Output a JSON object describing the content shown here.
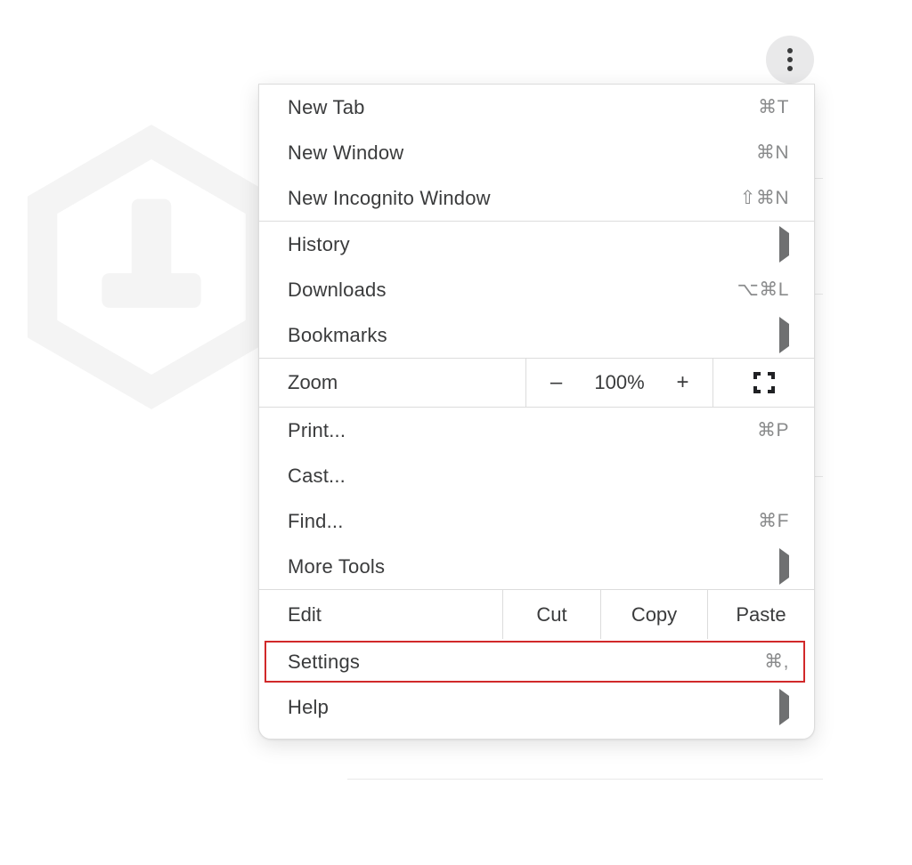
{
  "menu": {
    "section1": {
      "new_tab": {
        "label": "New Tab",
        "shortcut": "⌘T"
      },
      "new_window": {
        "label": "New Window",
        "shortcut": "⌘N"
      },
      "new_incognito": {
        "label": "New Incognito Window",
        "shortcut": "⇧⌘N"
      }
    },
    "section2": {
      "history": {
        "label": "History"
      },
      "downloads": {
        "label": "Downloads",
        "shortcut": "⌥⌘L"
      },
      "bookmarks": {
        "label": "Bookmarks"
      }
    },
    "zoom": {
      "label": "Zoom",
      "minus": "–",
      "value": "100%",
      "plus": "+"
    },
    "section3": {
      "print": {
        "label": "Print...",
        "shortcut": "⌘P"
      },
      "cast": {
        "label": "Cast..."
      },
      "find": {
        "label": "Find...",
        "shortcut": "⌘F"
      },
      "more_tools": {
        "label": "More Tools"
      }
    },
    "edit": {
      "label": "Edit",
      "cut": "Cut",
      "copy": "Copy",
      "paste": "Paste"
    },
    "section4": {
      "settings": {
        "label": "Settings",
        "shortcut": "⌘,"
      },
      "help": {
        "label": "Help"
      }
    }
  }
}
